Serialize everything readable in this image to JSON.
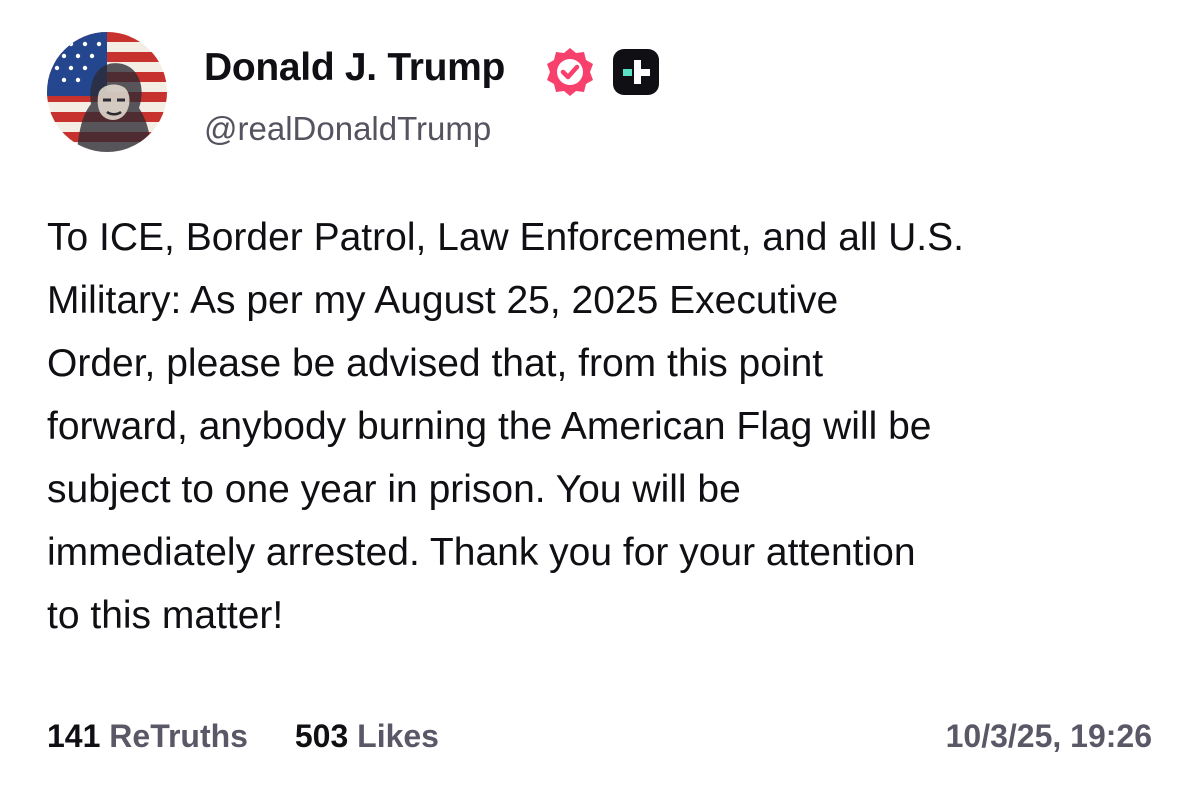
{
  "author": {
    "display_name": "Donald J. Trump",
    "handle": "@realDonaldTrump",
    "avatar_icon": "flag-portrait-avatar",
    "verified_icon": "verified-badge-icon",
    "verified_color": "#f7406b",
    "plus_icon": "truth-plus-icon",
    "plus_accent": "#5ce0c6"
  },
  "post": {
    "text_lines": [
      "To ICE, Border Patrol, Law Enforcement, and all U.S.",
      "Military: As per my August 25, 2025 Executive",
      "Order, please be advised that, from this point",
      "forward, anybody burning the American Flag will be",
      "subject to one year in prison. You will be",
      "immediately arrested. Thank you for your attention",
      "to this matter!"
    ]
  },
  "stats": {
    "retruths_count": "141",
    "retruths_label": "ReTruths",
    "likes_count": "503",
    "likes_label": "Likes"
  },
  "timestamp": "10/3/25, 19:26"
}
